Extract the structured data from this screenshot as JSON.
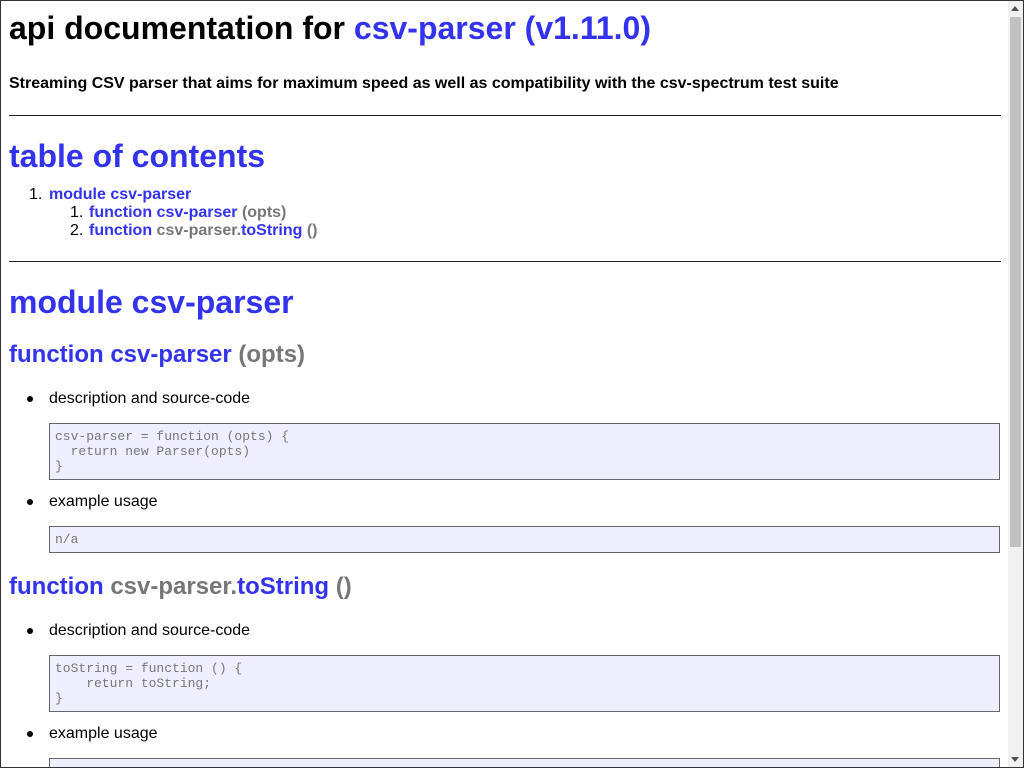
{
  "header": {
    "title_prefix": "api documentation for",
    "module_name": "csv-parser",
    "version": "(v1.11.0)",
    "tagline": "Streaming CSV parser that aims for maximum speed as well as compatibility with the csv-spectrum test suite"
  },
  "toc": {
    "heading": "table of contents",
    "items": [
      {
        "number": "1.",
        "label": "module csv-parser",
        "children": [
          {
            "number": "1.",
            "keyword": "function",
            "name": "csv-parser",
            "args": "(opts)"
          },
          {
            "number": "2.",
            "keyword": "function",
            "owner": "csv-parser.",
            "name": "toString",
            "args": "()"
          }
        ]
      }
    ]
  },
  "module": {
    "heading": "module csv-parser",
    "functions": [
      {
        "keyword": "function",
        "name": "csv-parser",
        "args": "(opts)",
        "source_label": "description and source-code",
        "source_code": "csv-parser = function (opts) {\n  return new Parser(opts)\n}",
        "example_label": "example usage",
        "example_code": "n/a"
      },
      {
        "keyword": "function",
        "owner": "csv-parser.",
        "name": "toString",
        "args": "()",
        "source_label": "description and source-code",
        "source_code": "toString = function () {\n    return toString;\n}",
        "example_label": "example usage",
        "example_code": "..."
      }
    ]
  },
  "colors": {
    "link": "#3333ee",
    "muted": "#777777",
    "code_bg": "#eeeeff"
  }
}
